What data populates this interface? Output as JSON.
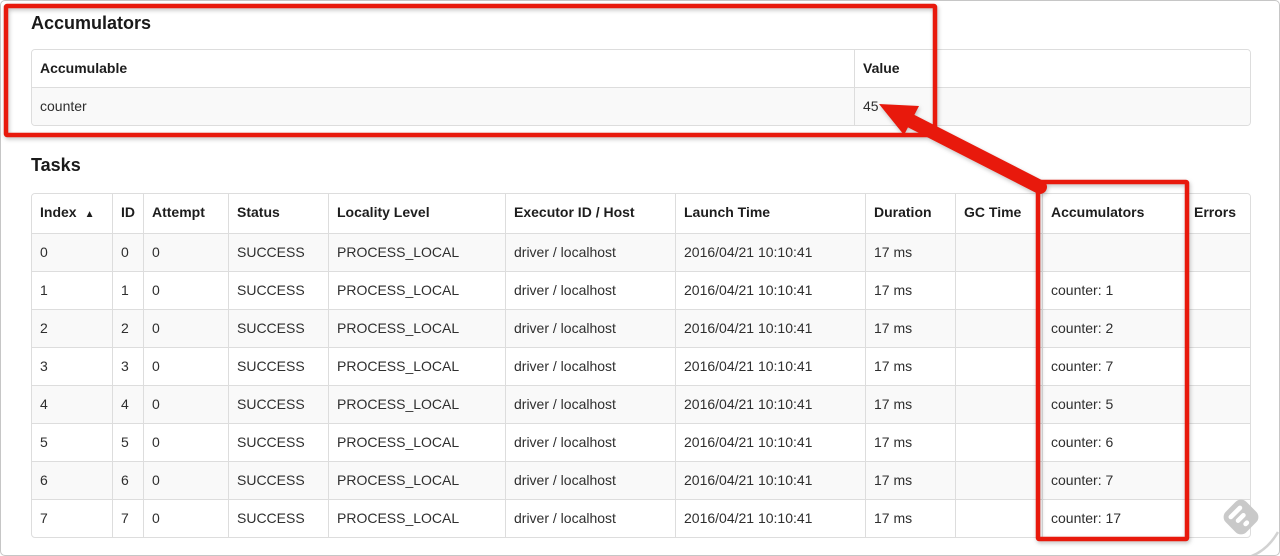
{
  "colors": {
    "annotation_red": "#e8190c",
    "table_border": "#dddddd",
    "stripe_row": "#f9f9f9"
  },
  "accumulators_section": {
    "title": "Accumulators",
    "table": {
      "headers": [
        "Accumulable",
        "Value"
      ],
      "rows": [
        {
          "accumulable": "counter",
          "value": "45"
        }
      ]
    }
  },
  "tasks_section": {
    "title": "Tasks",
    "table": {
      "headers": [
        {
          "label": "Index",
          "sort": "▲"
        },
        {
          "label": "ID"
        },
        {
          "label": "Attempt"
        },
        {
          "label": "Status"
        },
        {
          "label": "Locality Level"
        },
        {
          "label": "Executor ID / Host"
        },
        {
          "label": "Launch Time"
        },
        {
          "label": "Duration"
        },
        {
          "label": "GC Time"
        },
        {
          "label": "Accumulators"
        },
        {
          "label": "Errors"
        }
      ],
      "rows": [
        {
          "index": "0",
          "id": "0",
          "attempt": "0",
          "status": "SUCCESS",
          "locality_level": "PROCESS_LOCAL",
          "executor_id_host": "driver / localhost",
          "launch_time": "2016/04/21 10:10:41",
          "duration": "17 ms",
          "gc_time": "",
          "accumulators": "",
          "errors": ""
        },
        {
          "index": "1",
          "id": "1",
          "attempt": "0",
          "status": "SUCCESS",
          "locality_level": "PROCESS_LOCAL",
          "executor_id_host": "driver / localhost",
          "launch_time": "2016/04/21 10:10:41",
          "duration": "17 ms",
          "gc_time": "",
          "accumulators": "counter: 1",
          "errors": ""
        },
        {
          "index": "2",
          "id": "2",
          "attempt": "0",
          "status": "SUCCESS",
          "locality_level": "PROCESS_LOCAL",
          "executor_id_host": "driver / localhost",
          "launch_time": "2016/04/21 10:10:41",
          "duration": "17 ms",
          "gc_time": "",
          "accumulators": "counter: 2",
          "errors": ""
        },
        {
          "index": "3",
          "id": "3",
          "attempt": "0",
          "status": "SUCCESS",
          "locality_level": "PROCESS_LOCAL",
          "executor_id_host": "driver / localhost",
          "launch_time": "2016/04/21 10:10:41",
          "duration": "17 ms",
          "gc_time": "",
          "accumulators": "counter: 7",
          "errors": ""
        },
        {
          "index": "4",
          "id": "4",
          "attempt": "0",
          "status": "SUCCESS",
          "locality_level": "PROCESS_LOCAL",
          "executor_id_host": "driver / localhost",
          "launch_time": "2016/04/21 10:10:41",
          "duration": "17 ms",
          "gc_time": "",
          "accumulators": "counter: 5",
          "errors": ""
        },
        {
          "index": "5",
          "id": "5",
          "attempt": "0",
          "status": "SUCCESS",
          "locality_level": "PROCESS_LOCAL",
          "executor_id_host": "driver / localhost",
          "launch_time": "2016/04/21 10:10:41",
          "duration": "17 ms",
          "gc_time": "",
          "accumulators": "counter: 6",
          "errors": ""
        },
        {
          "index": "6",
          "id": "6",
          "attempt": "0",
          "status": "SUCCESS",
          "locality_level": "PROCESS_LOCAL",
          "executor_id_host": "driver / localhost",
          "launch_time": "2016/04/21 10:10:41",
          "duration": "17 ms",
          "gc_time": "",
          "accumulators": "counter: 7",
          "errors": ""
        },
        {
          "index": "7",
          "id": "7",
          "attempt": "0",
          "status": "SUCCESS",
          "locality_level": "PROCESS_LOCAL",
          "executor_id_host": "driver / localhost",
          "launch_time": "2016/04/21 10:10:41",
          "duration": "17 ms",
          "gc_time": "",
          "accumulators": "counter: 17",
          "errors": ""
        }
      ]
    }
  },
  "watermark": {
    "icon": "feedly-logo"
  }
}
